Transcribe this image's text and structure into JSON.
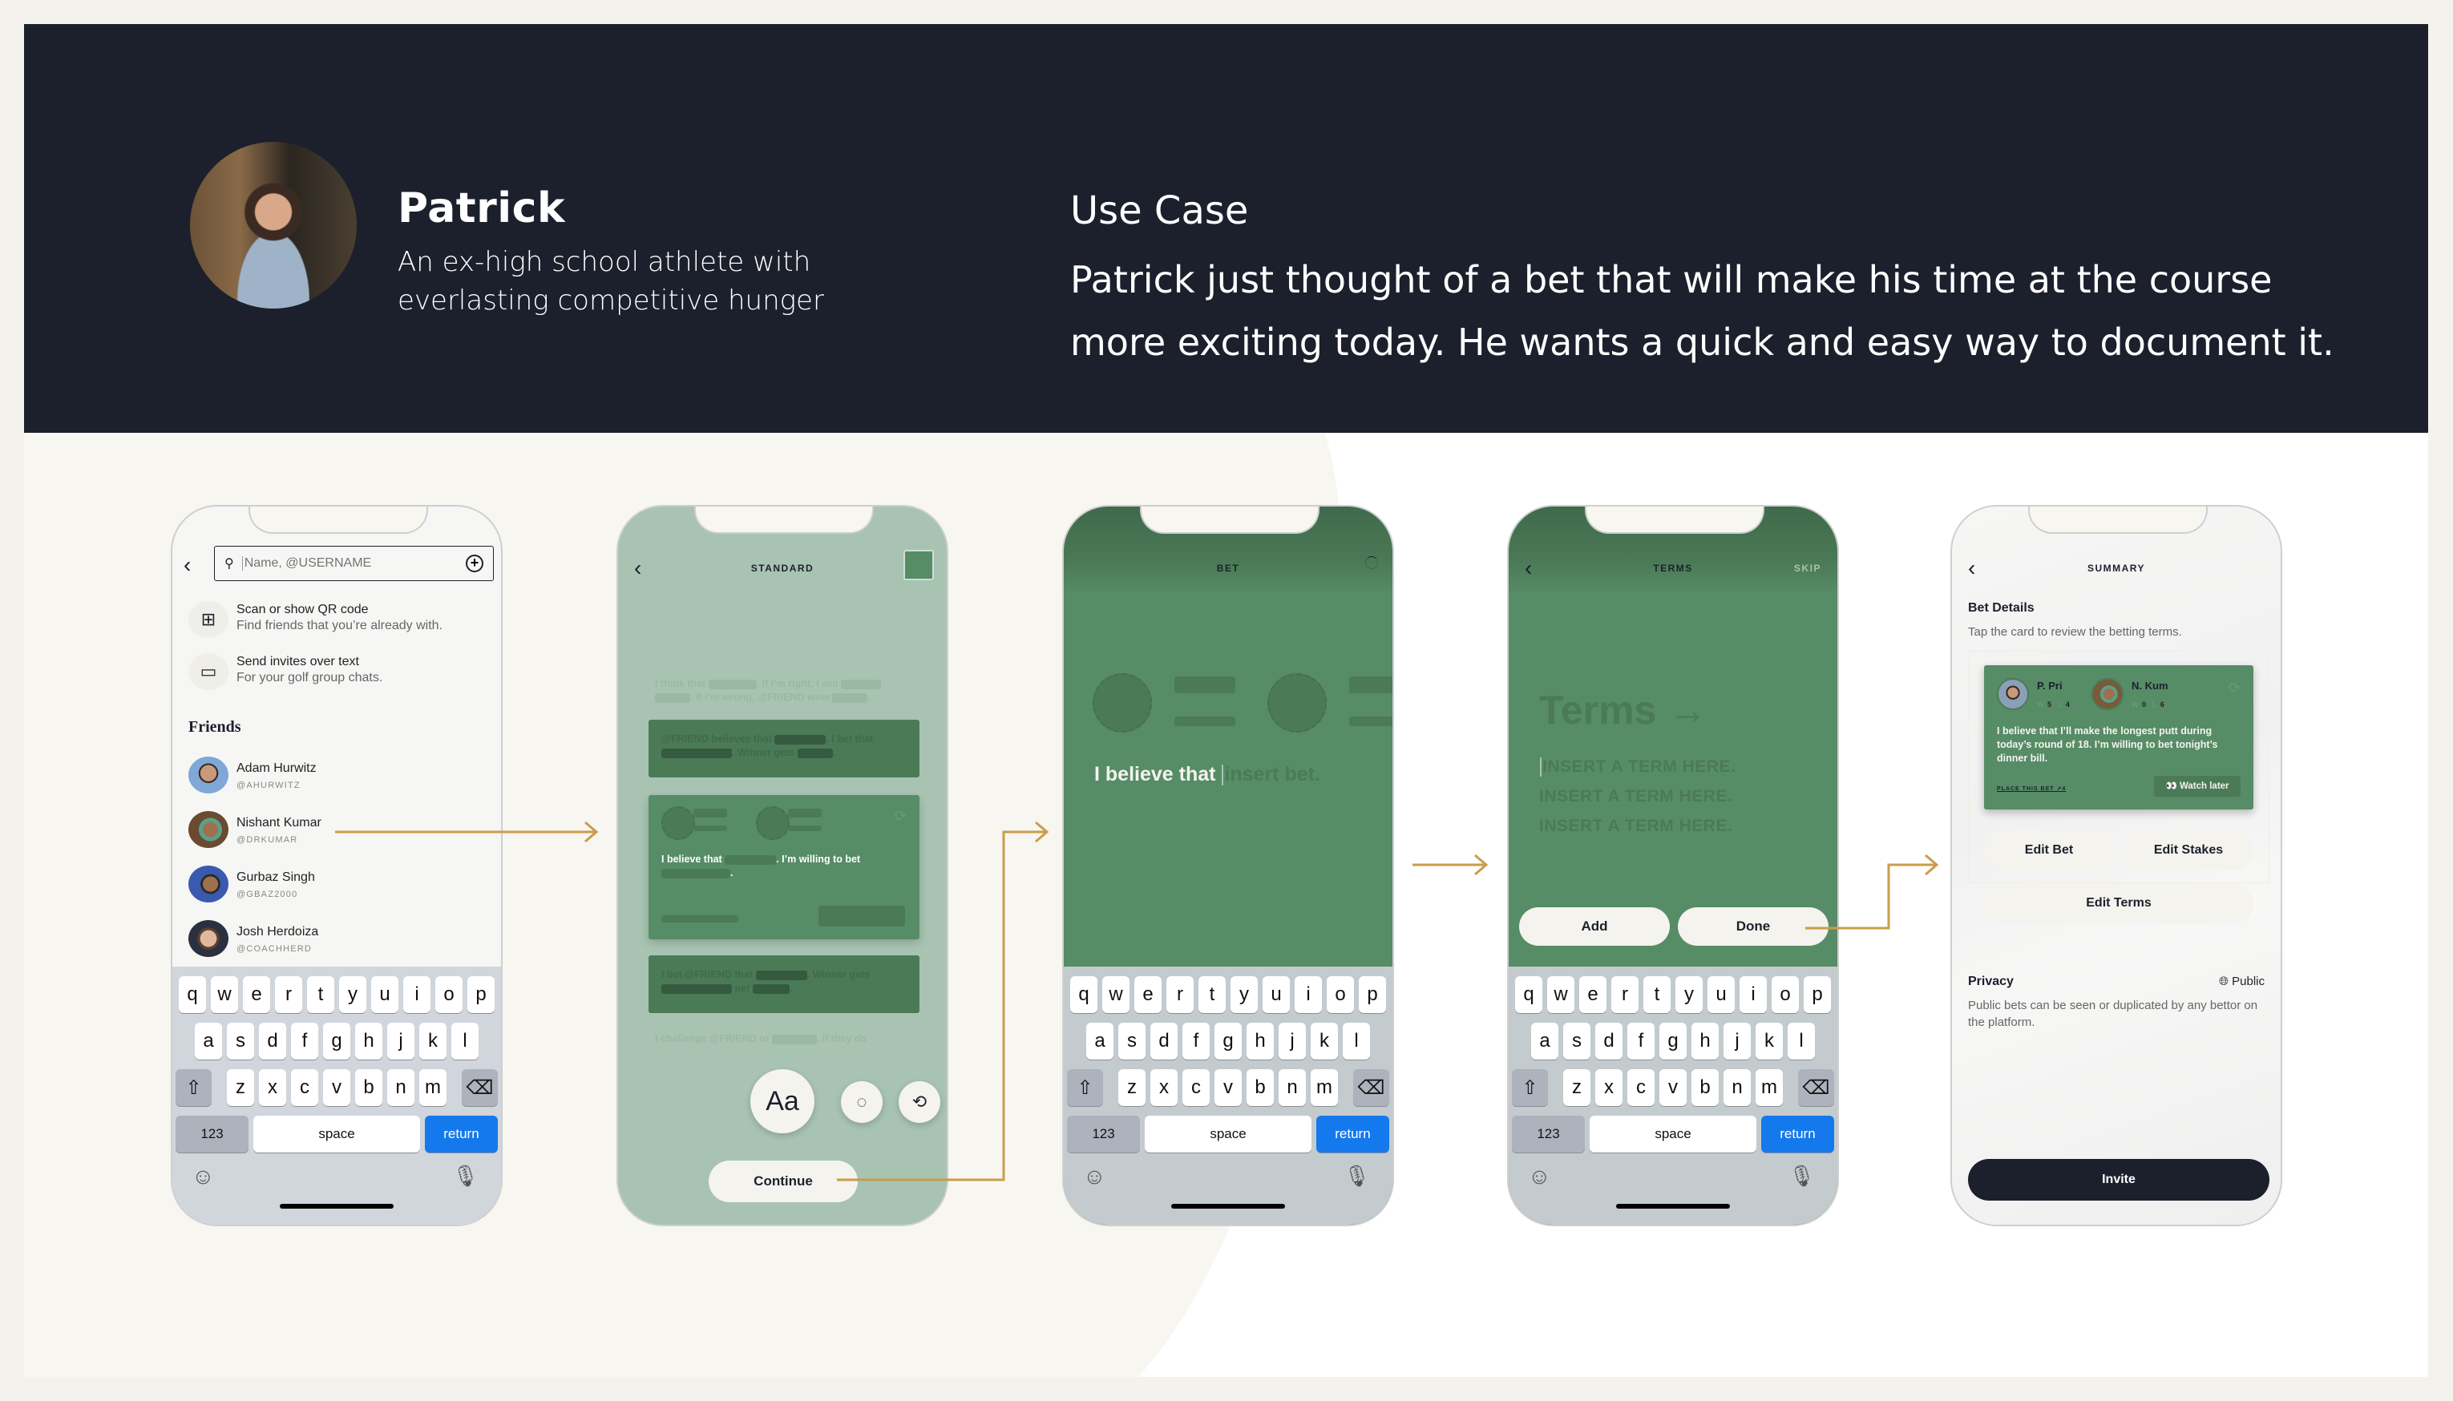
{
  "persona": {
    "name": "Patrick",
    "description": "An ex-high school athlete with everlasting competitive hunger",
    "avatar_icon": "person-photo"
  },
  "use_case": {
    "title": "Use Case",
    "text": "Patrick just thought of a bet that will make his time at the course more exciting today. He wants a quick and easy way to document it."
  },
  "colors": {
    "header_bg": "#1c202c",
    "accent_arrow": "#c99d4a",
    "green_dark": "#4b7a57",
    "green": "#568c66",
    "green_light": "#a8c3b2",
    "return_key": "#1479ec"
  },
  "keyboard": {
    "row1": [
      "q",
      "w",
      "e",
      "r",
      "t",
      "y",
      "u",
      "i",
      "o",
      "p"
    ],
    "row2": [
      "a",
      "s",
      "d",
      "f",
      "g",
      "h",
      "j",
      "k",
      "l"
    ],
    "row3": [
      "z",
      "x",
      "c",
      "v",
      "b",
      "n",
      "m"
    ],
    "numbers": "123",
    "space": "space",
    "return": "return",
    "shift_icon": "⇧",
    "delete_icon": "⌫",
    "emoji_icon": "☺",
    "mic_icon": "🎙"
  },
  "screens": {
    "friends": {
      "search_placeholder": "Name, @USERNAME",
      "options": [
        {
          "title": "Scan or show QR code",
          "subtitle": "Find friends that you’re already with.",
          "icon": "qr-code"
        },
        {
          "title": "Send invites over text",
          "subtitle": "For your golf group chats.",
          "icon": "message"
        }
      ],
      "friends_heading": "Friends",
      "friends": [
        {
          "name": "Adam Hurwitz",
          "handle": "@AHURWITZ"
        },
        {
          "name": "Nishant Kumar",
          "handle": "@DRKUMAR"
        },
        {
          "name": "Gurbaz Singh",
          "handle": "@GBAZ2000"
        },
        {
          "name": "Josh Herdoiza",
          "handle": "@COACHHERD"
        }
      ]
    },
    "standard": {
      "title": "STANDARD",
      "templates": {
        "ghost_top_a": "I think that",
        "ghost_top_b": ". If I’m right, I win",
        "ghost_top_c": ". If I’m wrong, @FRIEND wins",
        "card1_a": "@FRIEND believes that",
        "card1_b": ". I bet that",
        "card1_c": ". Winner gets",
        "main_a": "I believe that",
        "main_b": ". I’m willing to bet",
        "card3_a": "I bet @FRIEND that",
        "card3_b": ". Winner gets",
        "card3_c": "per",
        "ghost_bottom_a": "I challenge @FRIEND to",
        "ghost_bottom_b": ". If they do"
      },
      "font_button": "Aa",
      "continue": "Continue"
    },
    "bet": {
      "title": "BET",
      "prefix": "I believe that",
      "placeholder": "insert bet."
    },
    "terms": {
      "title": "TERMS",
      "skip": "SKIP",
      "heading": "Terms",
      "term_placeholders": [
        "INSERT A TERM HERE.",
        "INSERT A TERM HERE.",
        "INSERT A TERM HERE."
      ],
      "add": "Add",
      "done": "Done"
    },
    "summary": {
      "title": "SUMMARY",
      "bet_details_heading": "Bet Details",
      "bet_details_sub": "Tap the card to review the betting terms.",
      "card": {
        "player1": {
          "name": "P. Pri",
          "wins": "5",
          "losses": "4"
        },
        "player2": {
          "name": "N. Kum",
          "wins": "0",
          "losses": "6"
        },
        "win_label": "W",
        "loss_label": "L",
        "text": "I believe that I’ll make the longest putt during today’s round of 18. I’m willing to bet tonight’s dinner bill.",
        "place_bet": "PLACE THIS BET",
        "place_count": "4",
        "watch_later": "👀 Watch later"
      },
      "edit_bet": "Edit Bet",
      "edit_stakes": "Edit Stakes",
      "edit_terms": "Edit Terms",
      "privacy_heading": "Privacy",
      "privacy_value": "Public",
      "privacy_desc": "Public bets can be seen or duplicated by any bettor on the platform.",
      "invite": "Invite"
    }
  }
}
